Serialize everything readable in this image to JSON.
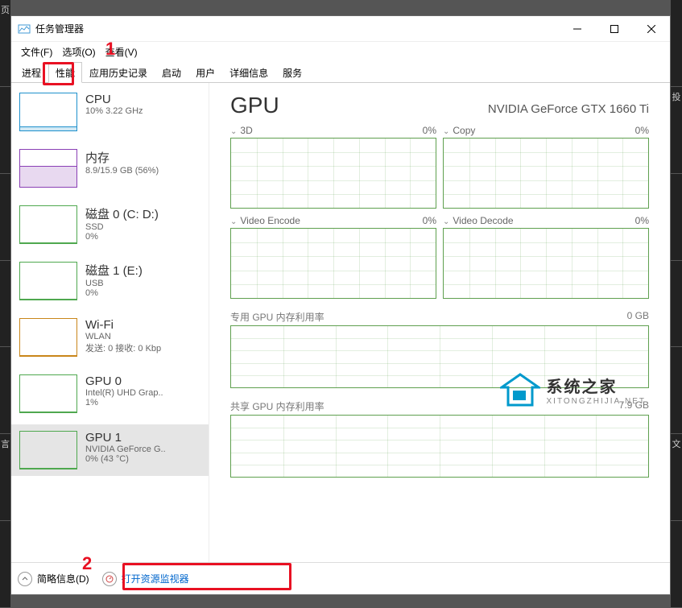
{
  "window": {
    "title": "任务管理器"
  },
  "menu": {
    "file": "文件(F)",
    "options": "选项(O)",
    "view": "查看(V)"
  },
  "tabs": [
    "进程",
    "性能",
    "应用历史记录",
    "启动",
    "用户",
    "详细信息",
    "服务"
  ],
  "active_tab_index": 1,
  "sidebar": [
    {
      "title": "CPU",
      "sub": "10%  3.22 GHz",
      "color": "#1e90cc",
      "fill_pct": 10
    },
    {
      "title": "内存",
      "sub": "8.9/15.9 GB (56%)",
      "color": "#8a3fb5",
      "fill_pct": 56
    },
    {
      "title": "磁盘 0 (C: D:)",
      "sub": "SSD",
      "sub2": "0%",
      "color": "#4fa84f",
      "fill_pct": 0
    },
    {
      "title": "磁盘 1 (E:)",
      "sub": "USB",
      "sub2": "0%",
      "color": "#4fa84f",
      "fill_pct": 0
    },
    {
      "title": "Wi-Fi",
      "sub": "WLAN",
      "sub2": "发送: 0 接收: 0 Kbp",
      "color": "#c9861a",
      "fill_pct": 0
    },
    {
      "title": "GPU 0",
      "sub": "Intel(R) UHD Grap..",
      "sub2": "1%",
      "color": "#4fa84f",
      "fill_pct": 1
    },
    {
      "title": "GPU 1",
      "sub": "NVIDIA GeForce G..",
      "sub2": "0% (43 °C)",
      "color": "#4fa84f",
      "fill_pct": 0,
      "selected": true
    }
  ],
  "main": {
    "heading": "GPU",
    "subheading": "NVIDIA GeForce GTX 1660 Ti",
    "panels": [
      {
        "label": "3D",
        "pct": "0%"
      },
      {
        "label": "Copy",
        "pct": "0%"
      },
      {
        "label": "Video Encode",
        "pct": "0%"
      },
      {
        "label": "Video Decode",
        "pct": "0%"
      }
    ],
    "dedicated": {
      "label": "专用 GPU 内存利用率",
      "right": "0 GB"
    },
    "shared": {
      "label": "共享 GPU 内存利用率",
      "right": "7.9 GB"
    }
  },
  "footer": {
    "fewer": "简略信息(D)",
    "resmon": "打开资源监视器"
  },
  "watermark": {
    "line1": "系统之家",
    "line2": "XITONGZHIJIA.NET"
  },
  "annotations": {
    "num1": "1",
    "num2": "2"
  }
}
